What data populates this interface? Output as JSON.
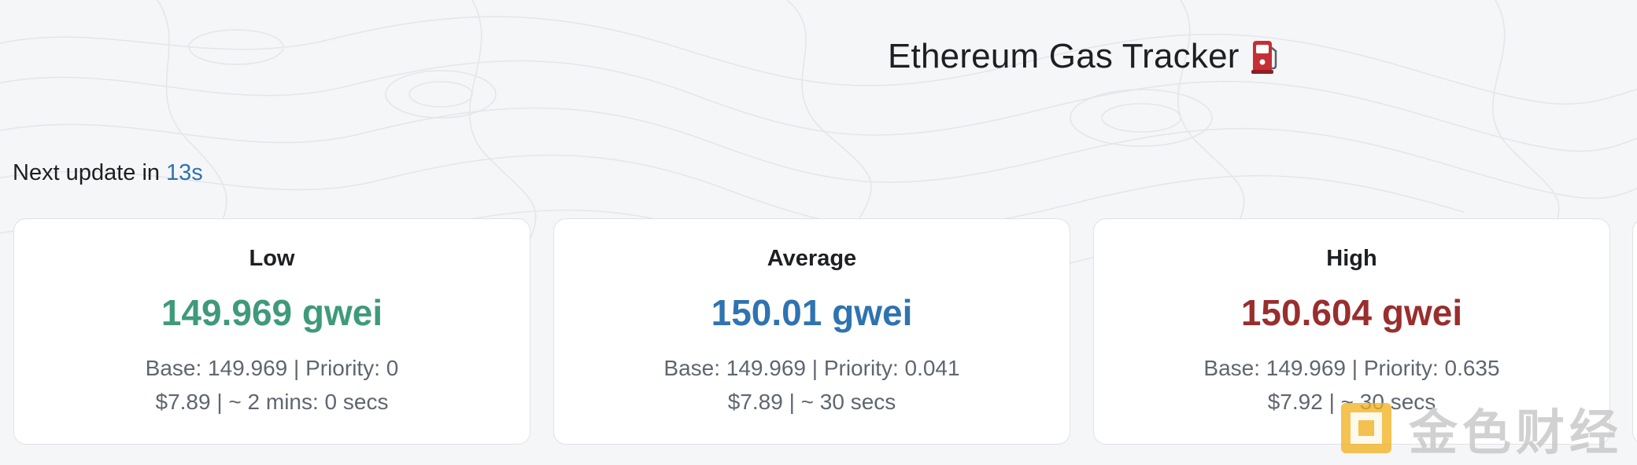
{
  "header": {
    "title": "Ethereum Gas Tracker",
    "title_icon": "fuel-pump-icon"
  },
  "update": {
    "prefix": "Next update in",
    "countdown": "13s"
  },
  "cards": {
    "low": {
      "label": "Low",
      "value": "149.969 gwei",
      "detail_base_priority": "Base: 149.969 | Priority: 0",
      "detail_cost_time": "$7.89 | ~ 2 mins: 0 secs"
    },
    "average": {
      "label": "Average",
      "value": "150.01 gwei",
      "detail_base_priority": "Base: 149.969 | Priority: 0.041",
      "detail_cost_time": "$7.89 | ~ 30 secs"
    },
    "high": {
      "label": "High",
      "value": "150.604 gwei",
      "detail_base_priority": "Base: 149.969 | Priority: 0.635",
      "detail_cost_time": "$7.92 | ~ 30 secs"
    }
  },
  "colors": {
    "low": "#3f9a7a",
    "average": "#2f73b0",
    "high": "#992e2e",
    "countdown": "#2f73b0",
    "pump": "#c62f35"
  },
  "watermark": {
    "text": "金色财经",
    "logo_icon": "jinse-logo-icon"
  }
}
